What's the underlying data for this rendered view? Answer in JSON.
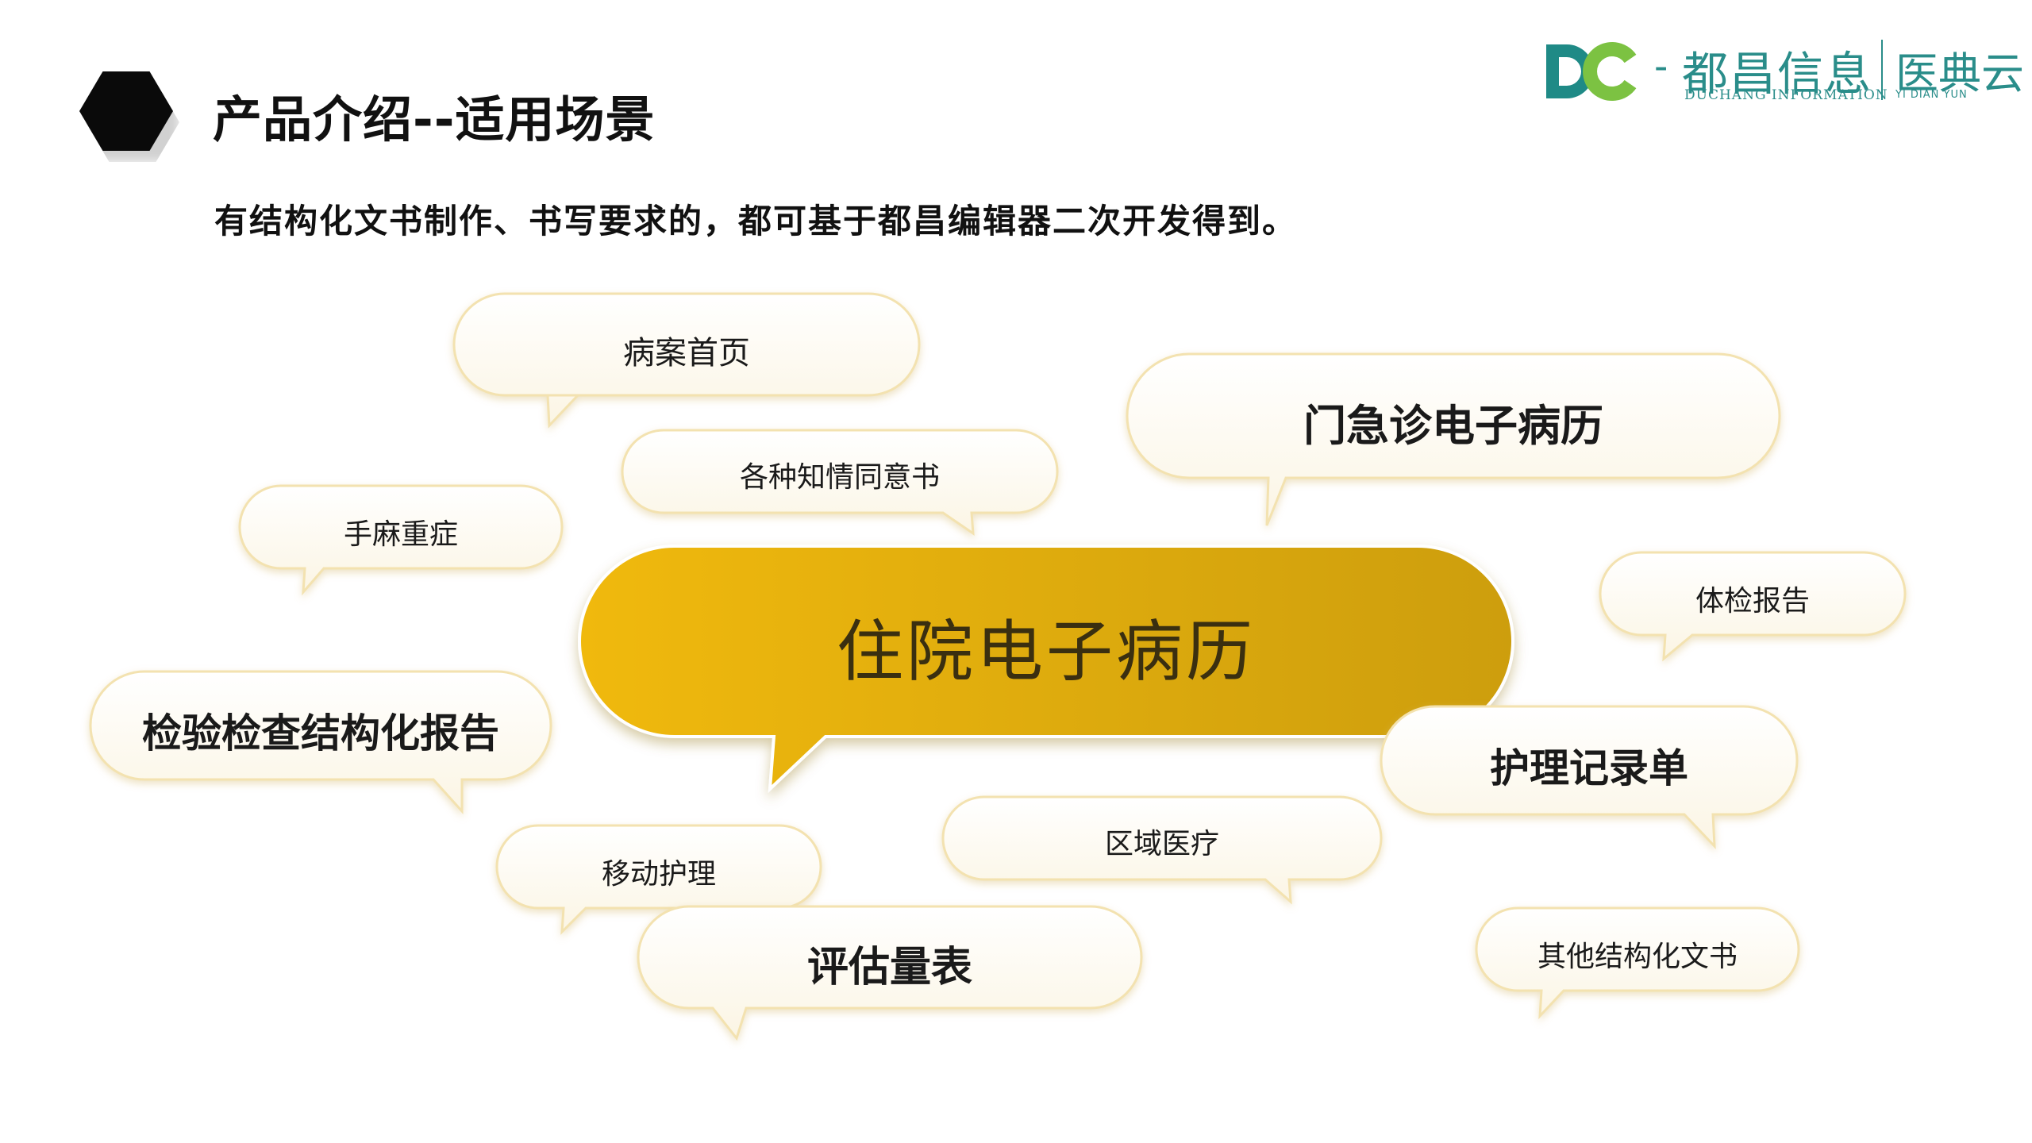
{
  "header": {
    "title": "产品介绍--适用场景",
    "subtitle": "有结构化文书制作、书写要求的，都可基于都昌编辑器二次开发得到。"
  },
  "logo": {
    "mark_text": "DC",
    "dash": "-",
    "name_cn": "都昌信息",
    "name_en": "DUCHANG INFORMATION",
    "product_cn": "医典云",
    "product_en": "YI DIAN YUN",
    "color": "#2a8d8a"
  },
  "center": {
    "label": "住院电子病历",
    "color_start": "#f0b90b",
    "color_end": "#cd9e0a"
  },
  "scenarios": {
    "s1": "病案首页",
    "s2": "各种知情同意书",
    "s3": "门急诊电子病历",
    "s4": "手麻重症",
    "s5": "体检报告",
    "s6": "检验检查结构化报告",
    "s7": "护理记录单",
    "s8": "移动护理",
    "s9": "区域医疗",
    "s10": "评估量表",
    "s11": "其他结构化文书"
  }
}
